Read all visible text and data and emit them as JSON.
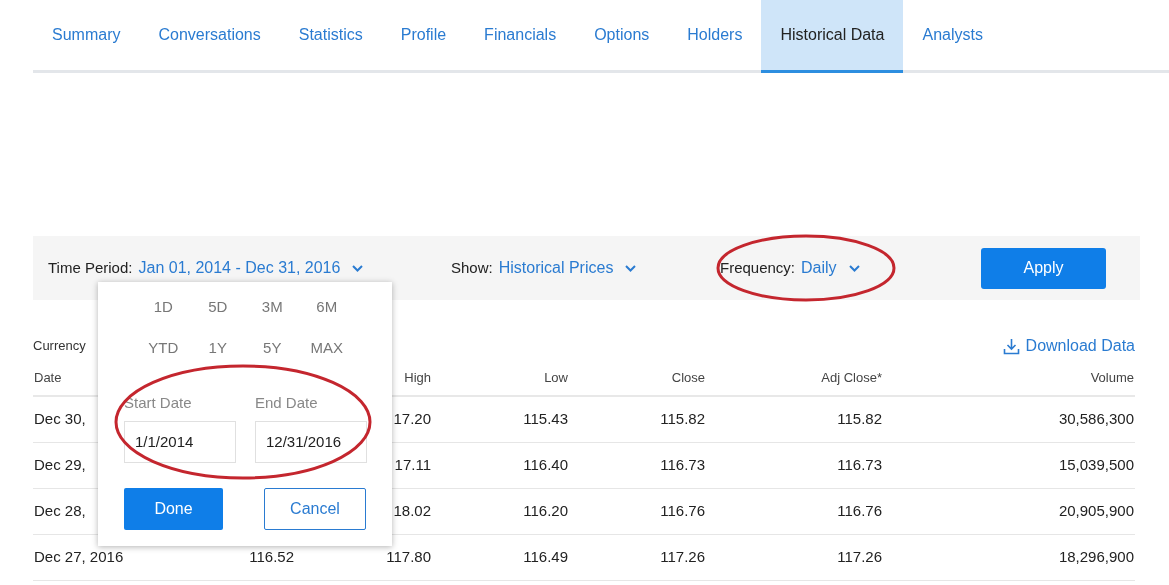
{
  "tabs": [
    {
      "label": "Summary",
      "selected": false
    },
    {
      "label": "Conversations",
      "selected": false
    },
    {
      "label": "Statistics",
      "selected": false
    },
    {
      "label": "Profile",
      "selected": false
    },
    {
      "label": "Financials",
      "selected": false
    },
    {
      "label": "Options",
      "selected": false
    },
    {
      "label": "Holders",
      "selected": false
    },
    {
      "label": "Historical Data",
      "selected": true
    },
    {
      "label": "Analysts",
      "selected": false
    }
  ],
  "filters": [
    {
      "kind": "dropdown",
      "label": "Time Period:",
      "value": "Jan 01, 2014 - Dec 31, 2016"
    },
    {
      "kind": "dropdown",
      "label": "Show:",
      "value": "Historical Prices"
    },
    {
      "kind": "dropdown",
      "label": "Frequency:",
      "value": "Daily"
    },
    {
      "kind": "button",
      "label": "Apply"
    }
  ],
  "currency_note": "Currency",
  "download_link": "Download Data",
  "table": {
    "columns": [
      "Date",
      null,
      "High",
      "Low",
      "Close",
      "Adj Close*",
      "Volume"
    ],
    "rows": [
      [
        "Dec 30,",
        null,
        "17.20",
        "115.43",
        "115.82",
        "115.82",
        "30,586,300"
      ],
      [
        "Dec 29,",
        null,
        "17.11",
        "116.40",
        "116.73",
        "116.73",
        "15,039,500"
      ],
      [
        "Dec 28,",
        null,
        "18.02",
        "116.20",
        "116.76",
        "116.76",
        "20,905,900"
      ],
      [
        "Dec 27, 2016",
        "116.52",
        "117.80",
        "116.49",
        "117.26",
        "117.26",
        "18,296,900"
      ]
    ]
  },
  "date_popup": {
    "ranges": [
      "1D",
      "5D",
      "3M",
      "6M",
      "YTD",
      "1Y",
      "5Y",
      "MAX"
    ],
    "start_label": "Start Date",
    "start_value": "1/1/2014",
    "end_label": "End Date",
    "end_value": "12/31/2016",
    "buttons": [
      {
        "kind": "primary",
        "label": "Done"
      },
      {
        "kind": "outline",
        "label": "Cancel"
      }
    ]
  },
  "annotations": [
    {
      "kind": "ellipse"
    },
    {
      "kind": "ellipse"
    }
  ]
}
